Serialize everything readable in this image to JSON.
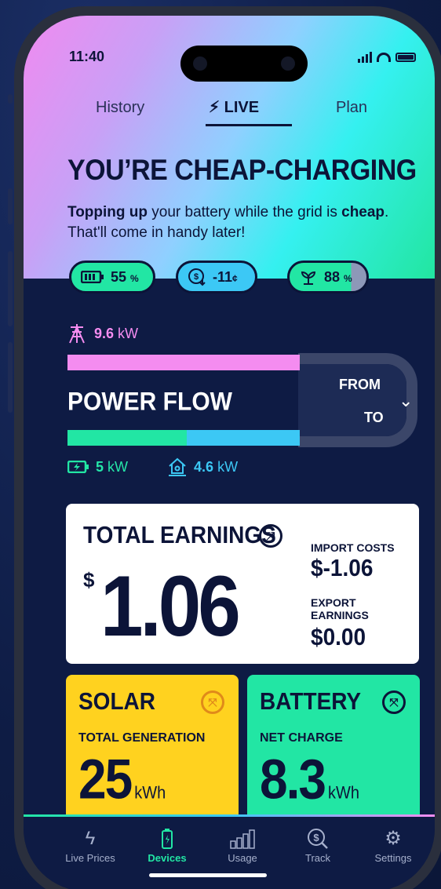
{
  "status_bar": {
    "time": "11:40"
  },
  "tabs": {
    "history": "History",
    "live": "LIVE",
    "plan": "Plan"
  },
  "hero": {
    "headline": "YOU’RE CHEAP-CHARGING",
    "text_bold_1": "Topping up",
    "text_1": " your battery while the grid is ",
    "text_bold_2": "cheap",
    "text_2": ". That'll come in handy later!"
  },
  "pills": {
    "battery": {
      "value": "55",
      "unit": "%"
    },
    "price": {
      "value": "-11",
      "unit": "¢"
    },
    "green": {
      "value": "88",
      "unit": "%"
    }
  },
  "power_flow": {
    "title": "POWER FLOW",
    "from_label": "FROM",
    "to_label": "TO",
    "grid": {
      "value": "9.6",
      "unit": "kW"
    },
    "battery": {
      "value": "5",
      "unit": "kW"
    },
    "home": {
      "value": "4.6",
      "unit": "kW"
    }
  },
  "earnings": {
    "title": "TOTAL EARNINGS",
    "currency": "$",
    "total": "1.06",
    "import_label": "IMPORT COSTS",
    "import_value": "$-1.06",
    "export_label_1": "EXPORT",
    "export_label_2": "EARNINGS",
    "export_value": "$0.00"
  },
  "solar": {
    "title": "SOLAR",
    "sub": "TOTAL GENERATION",
    "value": "25",
    "unit": "kWh"
  },
  "battery_card": {
    "title": "BATTERY",
    "sub": "NET CHARGE",
    "value": "8.3",
    "unit": "kWh"
  },
  "nav": {
    "live_prices": "Live Prices",
    "devices": "Devices",
    "usage": "Usage",
    "track": "Track",
    "settings": "Settings"
  },
  "colors": {
    "navy": "#0e1b44",
    "pink": "#f48cf0",
    "green": "#22e6a4",
    "blue": "#3cc8f5",
    "yellow": "#ffd21f"
  }
}
